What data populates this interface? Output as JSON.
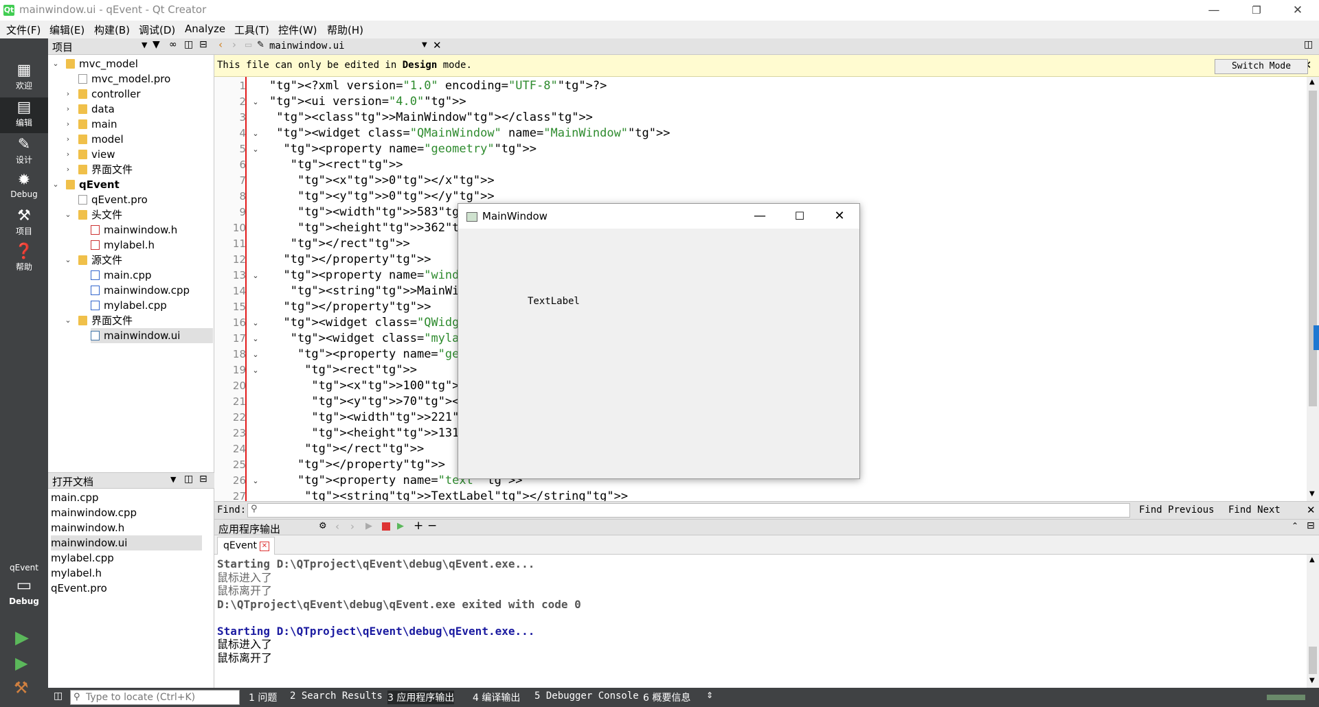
{
  "window": {
    "title": "mainwindow.ui - qEvent - Qt Creator",
    "logo": "Qt"
  },
  "menu": [
    "文件(F)",
    "编辑(E)",
    "构建(B)",
    "调试(D)",
    "Analyze",
    "工具(T)",
    "控件(W)",
    "帮助(H)"
  ],
  "modes": [
    {
      "label": "欢迎",
      "icon": "grid-icon"
    },
    {
      "label": "编辑",
      "icon": "edit-icon"
    },
    {
      "label": "设计",
      "icon": "pen-icon"
    },
    {
      "label": "Debug",
      "icon": "bug-icon"
    },
    {
      "label": "项目",
      "icon": "wrench-icon"
    },
    {
      "label": "帮助",
      "icon": "help-icon"
    }
  ],
  "kit": {
    "project": "qEvent",
    "mode": "Debug"
  },
  "project_panel": {
    "title": "项目",
    "tree": [
      {
        "label": "mvc_model",
        "bold": false
      },
      {
        "label": "mvc_model.pro"
      },
      {
        "label": "controller"
      },
      {
        "label": "data"
      },
      {
        "label": "main"
      },
      {
        "label": "model"
      },
      {
        "label": "view"
      },
      {
        "label": "界面文件"
      },
      {
        "label": "qEvent",
        "bold": true
      },
      {
        "label": "qEvent.pro"
      },
      {
        "label": "头文件"
      },
      {
        "label": "mainwindow.h"
      },
      {
        "label": "mylabel.h"
      },
      {
        "label": "源文件"
      },
      {
        "label": "main.cpp"
      },
      {
        "label": "mainwindow.cpp"
      },
      {
        "label": "mylabel.cpp"
      },
      {
        "label": "界面文件"
      },
      {
        "label": "mainwindow.ui"
      }
    ]
  },
  "open_docs": {
    "title": "打开文档",
    "items": [
      "main.cpp",
      "mainwindow.cpp",
      "mainwindow.h",
      "mainwindow.ui",
      "mylabel.cpp",
      "mylabel.h",
      "qEvent.pro"
    ],
    "selected": "mainwindow.ui"
  },
  "editor": {
    "file": "mainwindow.ui",
    "info": "This file can only be edited in Design mode.",
    "info_plain1": "This file can only be edited in ",
    "info_bold": "Design",
    "info_plain2": " mode.",
    "switch_mode": "Switch Mode",
    "line_numbers": [
      "1",
      "2",
      "3",
      "4",
      "5",
      "6",
      "7",
      "8",
      "9",
      "10",
      "11",
      "12",
      "13",
      "14",
      "15",
      "16",
      "17",
      "18",
      "19",
      "20",
      "21",
      "22",
      "23",
      "24",
      "25",
      "26",
      "27"
    ],
    "lines": [
      "<?xml version=\"1.0\" encoding=\"UTF-8\"?>",
      "<ui version=\"4.0\">",
      " <class>MainWindow</class>",
      " <widget class=\"QMainWindow\" name=\"MainWindow\">",
      "  <property name=\"geometry\">",
      "   <rect>",
      "    <x>0</x>",
      "    <y>0</y>",
      "    <width>583</width>",
      "    <height>362</height>",
      "   </rect>",
      "  </property>",
      "  <property name=\"windowT",
      "   <string>MainWindow</st",
      "  </property>",
      "  <widget class=\"QWidget\"",
      "   <widget class=\"mylabel",
      "    <property name=\"geome",
      "     <rect>",
      "      <x>100</x>",
      "      <y>70</y>",
      "      <width>221</width>",
      "      <height>131</height",
      "     </rect>",
      "    </property>",
      "    <property name=\"text\">",
      "     <string>TextLabel</string>"
    ]
  },
  "find": {
    "label": "Find:",
    "previous": "Find Previous",
    "next": "Find Next"
  },
  "output": {
    "title": "应用程序输出",
    "tab": "qEvent",
    "lines": [
      {
        "text": "Starting D:\\QTproject\\qEvent\\debug\\qEvent.exe...",
        "style": "gray"
      },
      {
        "text": "鼠标进入了",
        "style": "grayl"
      },
      {
        "text": "鼠标离开了",
        "style": "grayl"
      },
      {
        "text": "D:\\QTproject\\qEvent\\debug\\qEvent.exe exited with code 0",
        "style": "gray"
      },
      {
        "text": "",
        "style": "blk"
      },
      {
        "text": "Starting D:\\QTproject\\qEvent\\debug\\qEvent.exe...",
        "style": "blue"
      },
      {
        "text": "鼠标进入了",
        "style": "blk"
      },
      {
        "text": "鼠标离开了",
        "style": "blk"
      }
    ]
  },
  "statusbar": {
    "locate_placeholder": "Type to locate (Ctrl+K)",
    "panes": [
      "1 问题",
      "2 Search Results",
      "3 应用程序输出",
      "4 编译输出",
      "5 Debugger Console",
      "6 概要信息"
    ]
  },
  "app_window": {
    "title": "MainWindow",
    "label": "TextLabel"
  }
}
